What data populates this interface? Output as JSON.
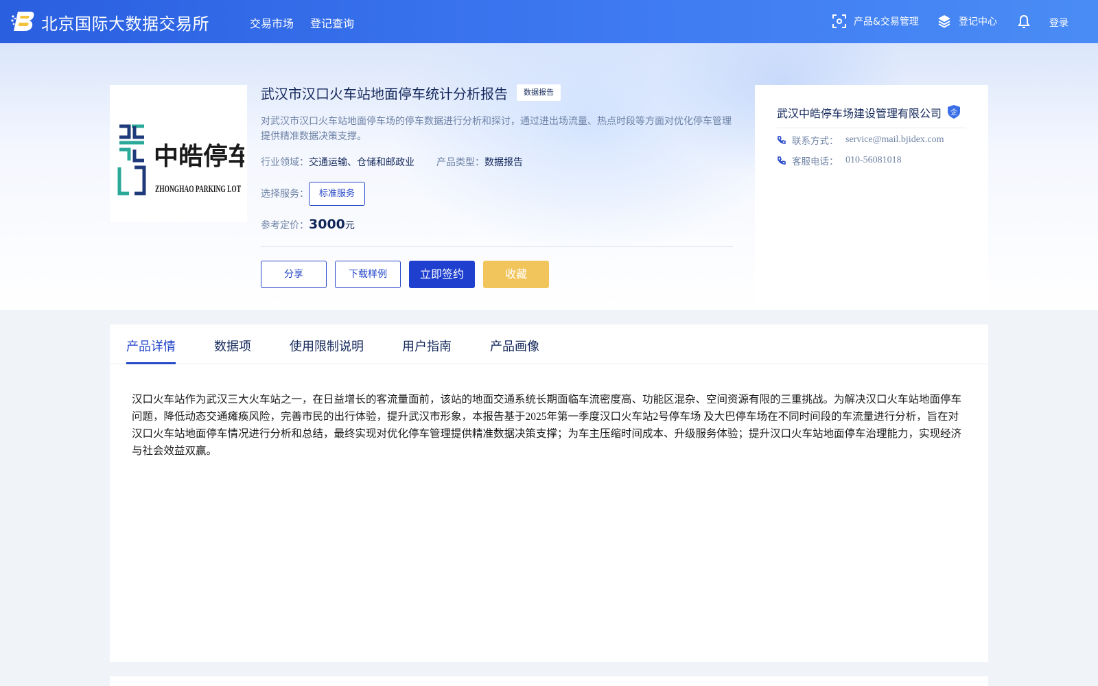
{
  "header": {
    "brand": "北京国际大数据交易所",
    "nav": [
      "交易市场",
      "登记查询"
    ],
    "right": {
      "product_mgmt": "产品&交易管理",
      "registry": "登记中心",
      "login": "登录"
    },
    "icons": [
      "logo-icon",
      "scan-icon",
      "layers-icon",
      "bell-icon"
    ]
  },
  "product": {
    "logo_text_cn": "中皓停车",
    "logo_text_en": "ZHONGHAO PARKING LOT",
    "title": "武汉市汉口火车站地面停车统计分析报告",
    "tag": "数据报告",
    "description": "对武汉市汉口火车站地面停车场的停车数据进行分析和探讨，通过进出场流量、热点时段等方面对优化停车管理提供精准数据决策支撑。",
    "industry_label": "行业领域：",
    "industry_value": "交通运输、仓储和邮政业",
    "type_label": "产品类型：",
    "type_value": "数据报告",
    "service_label": "选择服务：",
    "service_option": "标准服务",
    "price_label": "参考定价：",
    "price_value": "3000",
    "price_unit": "元",
    "actions": {
      "share": "分享",
      "download_sample": "下载样例",
      "sign": "立即签约",
      "favorite": "收藏"
    }
  },
  "provider": {
    "name": "武汉中皓停车场建设管理有限公司",
    "badge": "企",
    "contact_label": "联系方式：",
    "contact_value": "service@mail.bjidex.com",
    "phone_label": "客服电话：",
    "phone_value": "010-56081018"
  },
  "tabs": [
    "产品详情",
    "数据项",
    "使用限制说明",
    "用户指南",
    "产品画像"
  ],
  "active_tab": "产品详情",
  "detail_text": "汉口火车站作为武汉三大火车站之一，在日益增长的客流量面前，该站的地面交通系统长期面临车流密度高、功能区混杂、空间资源有限的三重挑战。为解决汉口火车站地面停车问题，降低动态交通瘫痪风险，完善市民的出行体验，提升武汉市形象，本报告基于2025年第一季度汉口火车站2号停车场 及大巴停车场在不同时间段的车流量进行分析，旨在对汉口火车站地面停车情况进行分析和总结，最终实现对优化停车管理提供精准数据决策支撑；为车主压缩时间成本、升级服务体验；提升汉口火车站地面停车治理能力，实现经济与社会效益双赢。",
  "colors": {
    "nav_gradient_start": "#2a5fe0",
    "nav_gradient_end": "#4a8cf5",
    "primary": "#1f3fcf",
    "favorite": "#f2c55c",
    "title_text": "#13275a",
    "muted_text": "#6f83a6"
  }
}
